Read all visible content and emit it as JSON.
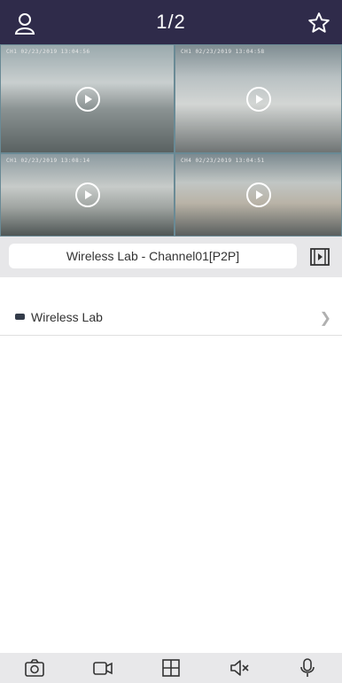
{
  "header": {
    "title": "1/2",
    "left_icon": "user-icon",
    "right_icon": "star-icon"
  },
  "cameras": [
    {
      "osd": "CH1 02/23/2019 13:04:56",
      "icon": "play-icon"
    },
    {
      "osd": "CH1 02/23/2019 13:04:58",
      "icon": "play-icon"
    },
    {
      "osd": "CH1 02/23/2019 13:08:14",
      "icon": "play-icon"
    },
    {
      "osd": "CH4 02/23/2019 13:04:51",
      "icon": "play-icon"
    }
  ],
  "selector": {
    "channel_label": "Wireless Lab - Channel01[P2P]",
    "playback_icon": "film-icon"
  },
  "device_list": [
    {
      "label": "Wireless Lab"
    }
  ],
  "toolbar": {
    "icons": [
      "camera-icon",
      "video-icon",
      "grid-icon",
      "mute-icon",
      "mic-icon"
    ]
  },
  "colors": {
    "header_bg": "#2f2b4a",
    "selector_bg": "#e7e7e9",
    "toolbar_bg": "#e8e8ea"
  }
}
